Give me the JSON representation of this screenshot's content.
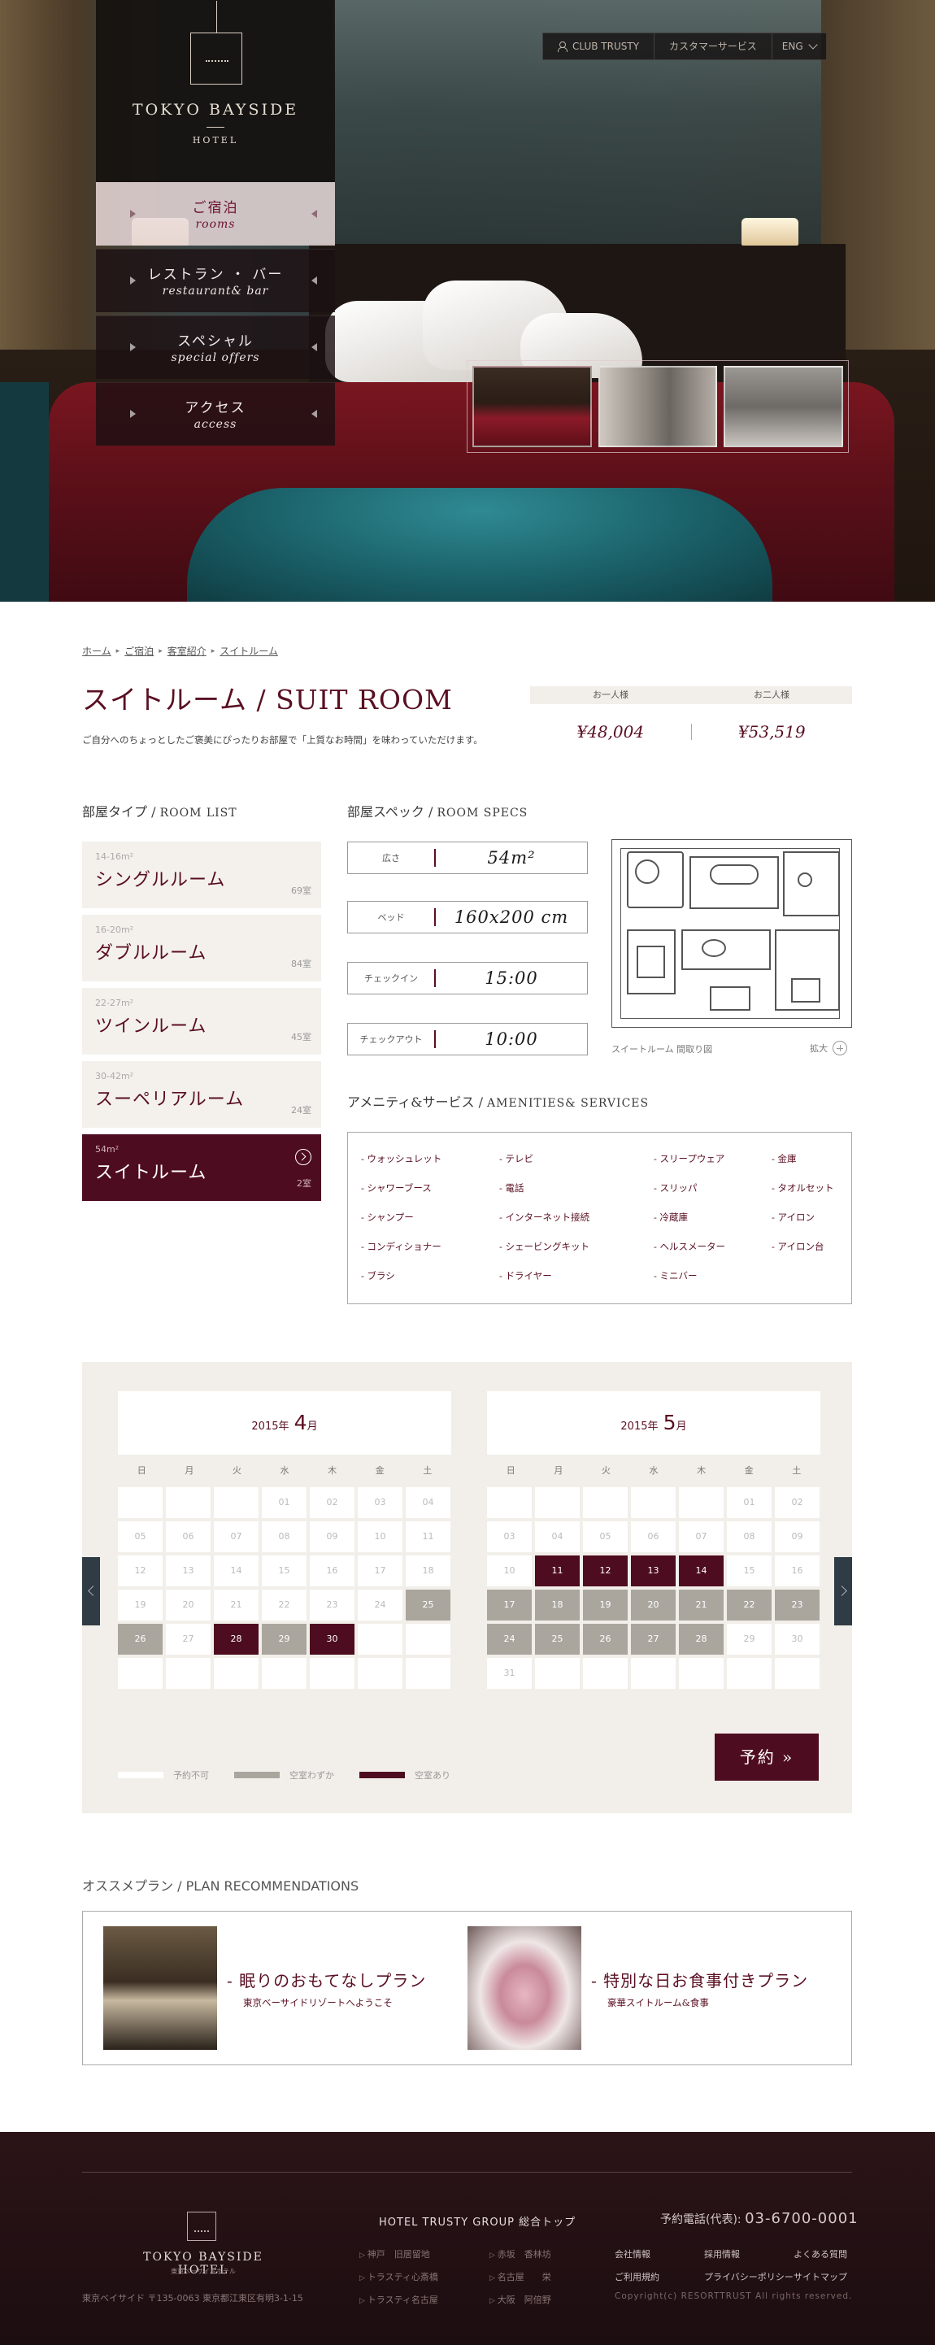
{
  "brand": {
    "name": "TOKYO BAYSIDE",
    "sub": "HOTEL"
  },
  "topbar": {
    "club": "CLUB TRUSTY",
    "customer": "カスタマーサービス",
    "lang": "ENG"
  },
  "nav": [
    {
      "jp": "ご宿泊",
      "en": "rooms",
      "active": true
    },
    {
      "jp": "レストラン ・ バー",
      "en": "restaurant& bar",
      "active": false
    },
    {
      "jp": "スペシャル",
      "en": "special offers",
      "active": false
    },
    {
      "jp": "アクセス",
      "en": "access",
      "active": false
    }
  ],
  "breadcrumb": [
    "ホーム",
    "ご宿泊",
    "客室紹介",
    "スイトルーム"
  ],
  "title": "スイトルーム / SUIT ROOM",
  "lead": "ご自分へのちょっとしたご褒美にぴったりお部屋で「上質なお時間」を味わっていただけます。",
  "price": {
    "h1": "お一人様",
    "h2": "お二人様",
    "v1": "¥48,004",
    "v2": "¥53,519"
  },
  "room_list": {
    "title_jp": "部屋タイプ",
    "title_en": "ROOM LIST",
    "items": [
      {
        "size": "14-16m²",
        "name": "シングルルーム",
        "count": "69室"
      },
      {
        "size": "16-20m²",
        "name": "ダブルルーム",
        "count": "84室"
      },
      {
        "size": "22-27m²",
        "name": "ツインルーム",
        "count": "45室"
      },
      {
        "size": "30-42m²",
        "name": "スーペリアルーム",
        "count": "24室"
      },
      {
        "size": "54m²",
        "name": "スイトルーム",
        "count": "2室"
      }
    ]
  },
  "specs": {
    "title_jp": "部屋スペック",
    "title_en": "ROOM SPECS",
    "items": [
      {
        "label": "広さ",
        "value": "54m²"
      },
      {
        "label": "ベッド",
        "value": "160x200 cm"
      },
      {
        "label": "チェックイン",
        "value": "15:00"
      },
      {
        "label": "チェックアウト",
        "value": "10:00"
      }
    ],
    "plan_caption": "スイートルーム 間取り図",
    "zoom": "拡大"
  },
  "amenities": {
    "title_jp": "アメニティ&サービス",
    "title_en": "AMENITIES& SERVICES",
    "items": [
      "ウォッシュレット",
      "テレビ",
      "スリープウェア",
      "金庫",
      "シャワーブース",
      "電話",
      "スリッパ",
      "タオルセット",
      "シャンプー",
      "インターネット接続",
      "冷蔵庫",
      "アイロン",
      "コンディショナー",
      "シェービングキット",
      "ヘルスメーター",
      "アイロン台",
      "ブラシ",
      "ドライヤー",
      "ミニバー",
      ""
    ]
  },
  "calendar": {
    "dow": [
      "日",
      "月",
      "火",
      "水",
      "木",
      "金",
      "土"
    ],
    "months": [
      {
        "year": "2015",
        "ylabel": "年",
        "month": "4",
        "mlabel": "月",
        "days": [
          "",
          "",
          "",
          "01",
          "02",
          "03",
          "04",
          "05",
          "06",
          "07",
          "08",
          "09",
          "10",
          "11",
          "12",
          "13",
          "14",
          "15",
          "16",
          "17",
          "18",
          "19",
          "20",
          "21",
          "22",
          "23",
          "24",
          "25",
          "26",
          "27",
          "28",
          "29",
          "30",
          "",
          "",
          "",
          "",
          "",
          "",
          "",
          "",
          ""
        ],
        "status": [
          "",
          "",
          "",
          "",
          "",
          "",
          "",
          "",
          "",
          "",
          "",
          "",
          "",
          "",
          "",
          "",
          "",
          "",
          "",
          "",
          "",
          "",
          "",
          "",
          "",
          "",
          "",
          "few",
          "few",
          "",
          "ok",
          "few",
          "ok",
          "",
          "",
          "",
          "",
          "",
          "",
          "",
          "",
          ""
        ]
      },
      {
        "year": "2015",
        "ylabel": "年",
        "month": "5",
        "mlabel": "月",
        "days": [
          "",
          "",
          "",
          "",
          "",
          "01",
          "02",
          "03",
          "04",
          "05",
          "06",
          "07",
          "08",
          "09",
          "10",
          "11",
          "12",
          "13",
          "14",
          "15",
          "16",
          "17",
          "18",
          "19",
          "20",
          "21",
          "22",
          "23",
          "24",
          "25",
          "26",
          "27",
          "28",
          "29",
          "30",
          "31",
          "",
          "",
          "",
          "",
          "",
          ""
        ],
        "status": [
          "",
          "",
          "",
          "",
          "",
          "",
          "",
          "",
          "",
          "",
          "",
          "",
          "",
          "",
          "",
          "ok",
          "ok",
          "ok",
          "ok",
          "",
          "",
          "few",
          "few",
          "few",
          "few",
          "few",
          "few",
          "few",
          "few",
          "few",
          "few",
          "few",
          "few",
          "",
          "",
          "",
          "",
          "",
          "",
          "",
          "",
          ""
        ]
      }
    ],
    "legend": [
      "予約不可",
      "空室わずか",
      "空室あり"
    ],
    "book": "予約 »"
  },
  "plans": {
    "title": "オススメプラン / PLAN RECOMMENDATIONS",
    "items": [
      {
        "title": "- 眠りのおもてなしプラン",
        "sub": "東京ベーサイドリゾートへようこそ"
      },
      {
        "title": "- 特別な日お食事付きプラン",
        "sub": "豪華スイトルーム&食事"
      }
    ]
  },
  "footer": {
    "name": "TOKYO BAYSIDE HOTEL",
    "sub": "東京ベーサイドホテル",
    "address": "東京ベイサイド 〒135-0063 東京都江東区有明3-1-15",
    "group": "HOTEL TRUSTY GROUP 総合トップ",
    "links": [
      "神戸　旧居留地",
      "赤坂　香林坊",
      "トラスティ心斎橋",
      "名古屋　　栄",
      "トラスティ名古屋",
      "大阪　阿倍野"
    ],
    "phone_label": "予約電話(代表):",
    "phone": "03-6700-0001",
    "nav": [
      "会社情報",
      "採用情報",
      "よくある質問",
      "ご利用規約",
      "プライバシーポリシー",
      "サイトマップ"
    ],
    "copyright": "Copyright(c) RESORTTRUST All rights reserved."
  },
  "colors": {
    "accent": "#4e0c20",
    "few": "#aaa69e",
    "panel": "#f2efea"
  }
}
